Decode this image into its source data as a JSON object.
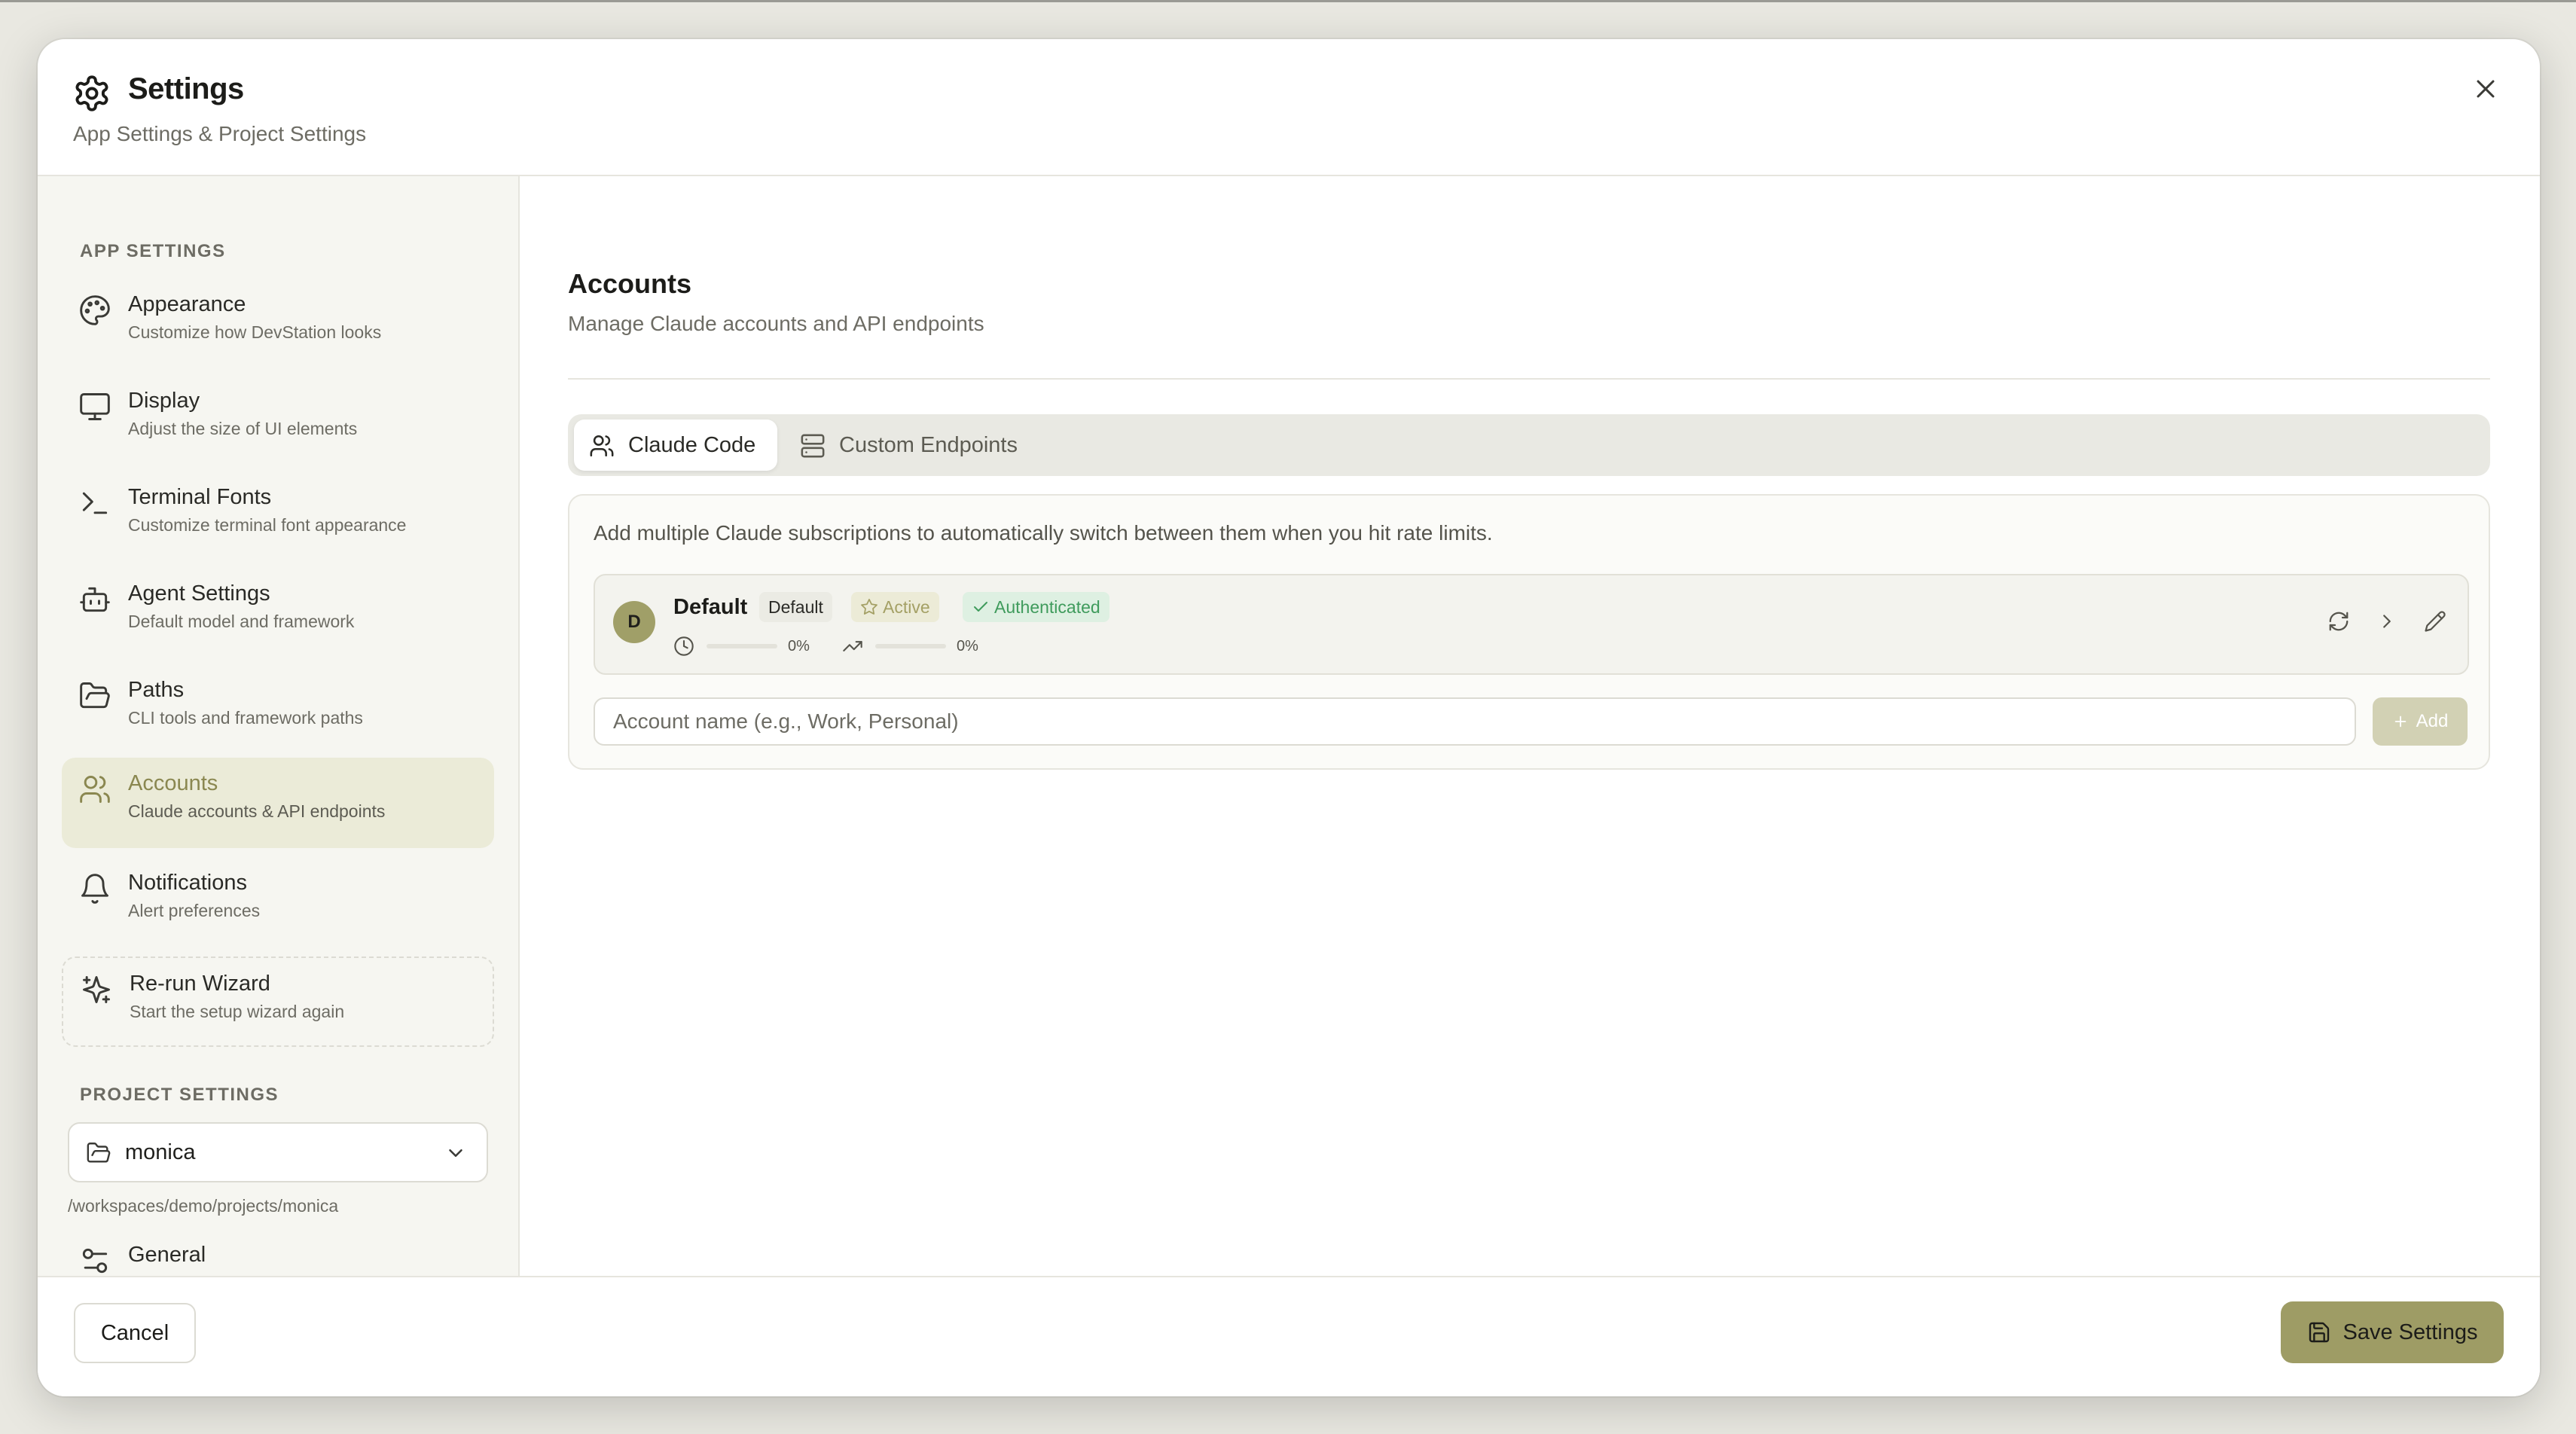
{
  "dialog": {
    "title": "Settings",
    "subtitle": "App Settings & Project Settings"
  },
  "sidebar": {
    "app_section_label": "APP SETTINGS",
    "items": [
      {
        "label": "Appearance",
        "desc": "Customize how DevStation looks",
        "icon": "palette-icon"
      },
      {
        "label": "Display",
        "desc": "Adjust the size of UI elements",
        "icon": "monitor-icon"
      },
      {
        "label": "Terminal Fonts",
        "desc": "Customize terminal font appearance",
        "icon": "terminal-icon"
      },
      {
        "label": "Agent Settings",
        "desc": "Default model and framework",
        "icon": "bot-icon"
      },
      {
        "label": "Paths",
        "desc": "CLI tools and framework paths",
        "icon": "folder-icon"
      },
      {
        "label": "Accounts",
        "desc": "Claude accounts & API endpoints",
        "icon": "users-icon",
        "active": true
      },
      {
        "label": "Notifications",
        "desc": "Alert preferences",
        "icon": "bell-icon"
      }
    ],
    "wizard": {
      "label": "Re-run Wizard",
      "desc": "Start the setup wizard again"
    },
    "project_section_label": "PROJECT SETTINGS",
    "project_select": {
      "value": "monica",
      "path": "/workspaces/demo/projects/monica"
    },
    "general_label": "General"
  },
  "content": {
    "title": "Accounts",
    "subtitle": "Manage Claude accounts and API endpoints",
    "tabs": [
      {
        "label": "Claude Code",
        "active": true
      },
      {
        "label": "Custom Endpoints",
        "active": false
      }
    ],
    "panel_desc": "Add multiple Claude subscriptions to automatically switch between them when you hit rate limits.",
    "account": {
      "avatar_letter": "D",
      "name": "Default",
      "badge_default": "Default",
      "badge_active": "Active",
      "badge_auth": "Authenticated",
      "usage_session_pct": "0%",
      "usage_weekly_pct": "0%"
    },
    "input_placeholder": "Account name (e.g., Work, Personal)",
    "add_label": "Add"
  },
  "footer": {
    "cancel_label": "Cancel",
    "save_label": "Save Settings"
  },
  "colors": {
    "accent": "#9e9c65",
    "active_bg": "#ebebd8",
    "auth_green": "#3f9b5c"
  }
}
